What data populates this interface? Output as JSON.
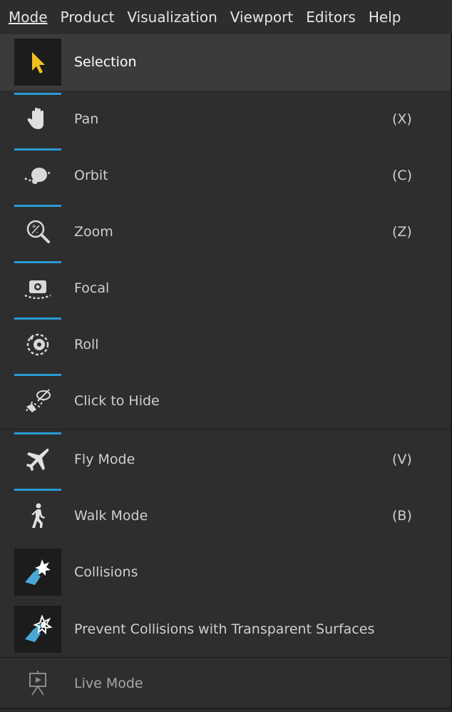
{
  "menubar": {
    "items": [
      {
        "label": "Mode"
      },
      {
        "label": "Product"
      },
      {
        "label": "Visualization"
      },
      {
        "label": "Viewport"
      },
      {
        "label": "Editors"
      },
      {
        "label": "Help"
      }
    ]
  },
  "menu": {
    "items": [
      {
        "label": "Selection",
        "shortcut": "",
        "icon": "cursor-icon",
        "selected": true
      },
      {
        "label": "Pan",
        "shortcut": "(X)",
        "icon": "hand-icon"
      },
      {
        "label": "Orbit",
        "shortcut": "(C)",
        "icon": "orbit-icon"
      },
      {
        "label": "Zoom",
        "shortcut": "(Z)",
        "icon": "zoom-icon"
      },
      {
        "label": "Focal",
        "shortcut": "",
        "icon": "camera-icon"
      },
      {
        "label": "Roll",
        "shortcut": "",
        "icon": "roll-icon"
      },
      {
        "label": "Click to Hide",
        "shortcut": "",
        "icon": "click-to-hide-icon"
      },
      {
        "label": "Fly Mode",
        "shortcut": "(V)",
        "icon": "airplane-icon"
      },
      {
        "label": "Walk Mode",
        "shortcut": "(B)",
        "icon": "walking-person-icon"
      },
      {
        "label": "Collisions",
        "shortcut": "",
        "icon": "collision-icon",
        "checked": true
      },
      {
        "label": "Prevent Collisions with Transparent Surfaces",
        "shortcut": "",
        "icon": "transparent-collision-icon",
        "checked": true
      },
      {
        "label": "Live Mode",
        "shortcut": "",
        "icon": "presentation-icon",
        "disabled": true
      }
    ]
  },
  "colors": {
    "accent": "#2a9bd4",
    "selection_cursor": "#f0c020",
    "collision_icon": "#4aa8d8"
  }
}
